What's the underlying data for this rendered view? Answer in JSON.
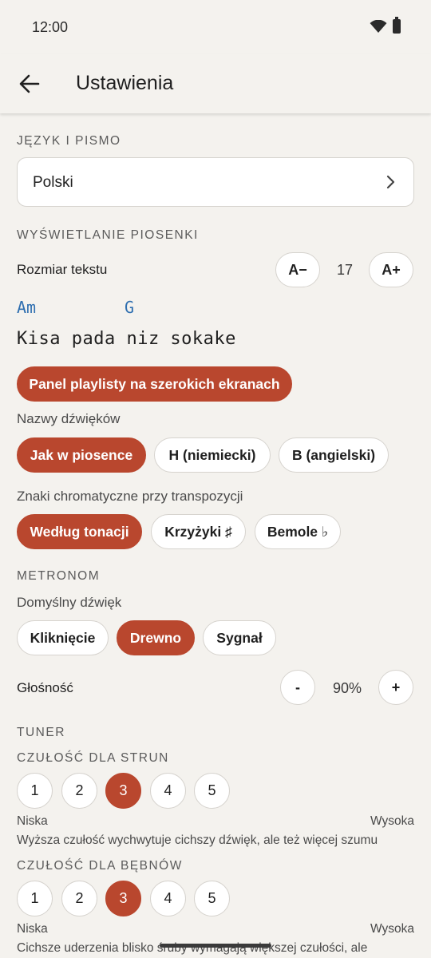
{
  "status": {
    "time": "12:00",
    "wifi_icon": "wifi-icon",
    "battery_icon": "battery-icon"
  },
  "appbar": {
    "title": "Ustawienia",
    "back_icon": "arrow-back-icon"
  },
  "language": {
    "section": "JĘZYK I PISMO",
    "value": "Polski",
    "chevron_icon": "chevron-right-icon"
  },
  "display": {
    "section": "WYŚWIETLANIE PIOSENKI",
    "text_size_label": "Rozmiar tekstu",
    "decrease_label": "A−",
    "size_value": "17",
    "increase_label": "A+",
    "preview_chord_1": "Am",
    "preview_chord_2": "G",
    "preview_lyric": "Kisa pada niz sokake",
    "playlist_panel_label": "Panel playlisty na szerokich ekranach",
    "note_names_label": "Nazwy dźwięków",
    "note_names_options": [
      "Jak w piosence",
      "H (niemiecki)",
      "B (angielski)"
    ],
    "note_names_selected": "Jak w piosence",
    "accidentals_label": "Znaki chromatyczne przy transpozycji",
    "accidentals_options": [
      "Według tonacji",
      "Krzyżyki ♯",
      "Bemole ♭"
    ],
    "accidentals_selected": "Według tonacji"
  },
  "metronome": {
    "section": "METRONOM",
    "sound_label": "Domyślny dźwięk",
    "sound_options": [
      "Kliknięcie",
      "Drewno",
      "Sygnał"
    ],
    "sound_selected": "Drewno",
    "volume_label": "Głośność",
    "volume_minus": "-",
    "volume_value": "90%",
    "volume_plus": "+"
  },
  "tuner": {
    "section": "TUNER",
    "strings_label": "CZUŁOŚĆ DLA STRUN",
    "strings_options": [
      "1",
      "2",
      "3",
      "4",
      "5"
    ],
    "strings_selected": "3",
    "strings_low": "Niska",
    "strings_high": "Wysoka",
    "strings_hint": "Wyższa czułość wychwytuje cichszy dźwięk, ale też więcej szumu",
    "drums_label": "CZUŁOŚĆ DLA BĘBNÓW",
    "drums_options": [
      "1",
      "2",
      "3",
      "4",
      "5"
    ],
    "drums_selected": "3",
    "drums_low": "Niska",
    "drums_high": "Wysoka",
    "drums_hint": "Cichsze uderzenia blisko śruby wymagają większej czułości, ale"
  },
  "colors": {
    "accent": "#b9472e",
    "background": "#f4f2ee",
    "chord": "#2f6fb0"
  }
}
